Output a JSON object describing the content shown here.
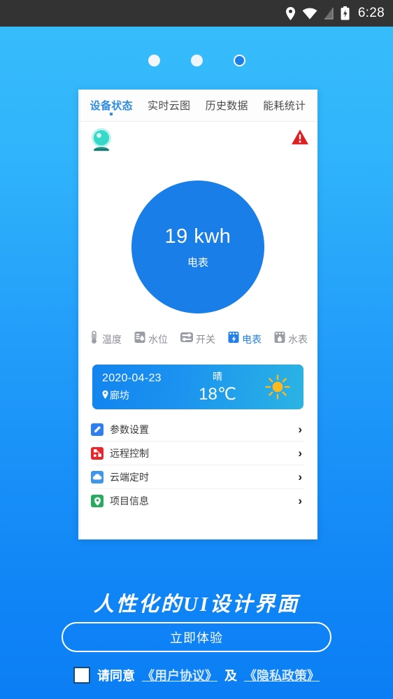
{
  "status_bar": {
    "icons": [
      "location-pin-icon",
      "wifi-icon",
      "signal-icon",
      "battery-charging-icon"
    ],
    "time": "6:28"
  },
  "carousel": {
    "dots": [
      "dot-1",
      "dot-2",
      "dot-3"
    ],
    "active_index": 2
  },
  "card": {
    "tabs": [
      {
        "label": "设备状态",
        "active": true
      },
      {
        "label": "实时云图",
        "active": false
      },
      {
        "label": "历史数据",
        "active": false
      },
      {
        "label": "能耗统计",
        "active": false
      }
    ],
    "gauge": {
      "camera_icon": "webcam-icon",
      "warning_icon": "warning-triangle-icon",
      "value": "19 kwh",
      "unit_label": "电表",
      "circle_color": "#1a7ee8"
    },
    "device_types": [
      {
        "label": "温度",
        "icon": "thermometer-icon",
        "active": false
      },
      {
        "label": "水位",
        "icon": "water-level-icon",
        "active": false
      },
      {
        "label": "开关",
        "icon": "switch-icon",
        "active": false
      },
      {
        "label": "电表",
        "icon": "electric-meter-icon",
        "active": true
      },
      {
        "label": "水表",
        "icon": "water-meter-icon",
        "active": false
      }
    ],
    "weather": {
      "date": "2020-04-23",
      "location": "廊坊",
      "location_icon": "location-pin-icon",
      "condition": "晴",
      "temperature": "18℃",
      "weather_icon": "sun-icon"
    },
    "menu": [
      {
        "label": "参数设置",
        "icon": "pencil-icon",
        "icon_color": "#2f7ff0",
        "chevron": "›"
      },
      {
        "label": "远程控制",
        "icon": "remote-control-icon",
        "icon_color": "#e8262b",
        "chevron": "›"
      },
      {
        "label": "云端定时",
        "icon": "cloud-icon",
        "icon_color": "#3f95ea",
        "chevron": "›"
      },
      {
        "label": "项目信息",
        "icon": "map-pin-icon",
        "icon_color": "#27ab5e",
        "chevron": "›"
      }
    ]
  },
  "promo": {
    "tagline": "人性化的UI设计界面",
    "cta_label": "立即体验",
    "agree_prefix": "请同意",
    "agree_link_1": "《用户协议》",
    "agree_conjunction": "及",
    "agree_link_2": "《隐私政策》",
    "checkbox_checked": false
  },
  "colors": {
    "bg_top": "#38bdfb",
    "bg_bottom": "#0b7ef5",
    "accent": "#1a7ee8",
    "tab_active": "#2f8ce2",
    "warning": "#e02020",
    "camera": "#37d8c8"
  }
}
